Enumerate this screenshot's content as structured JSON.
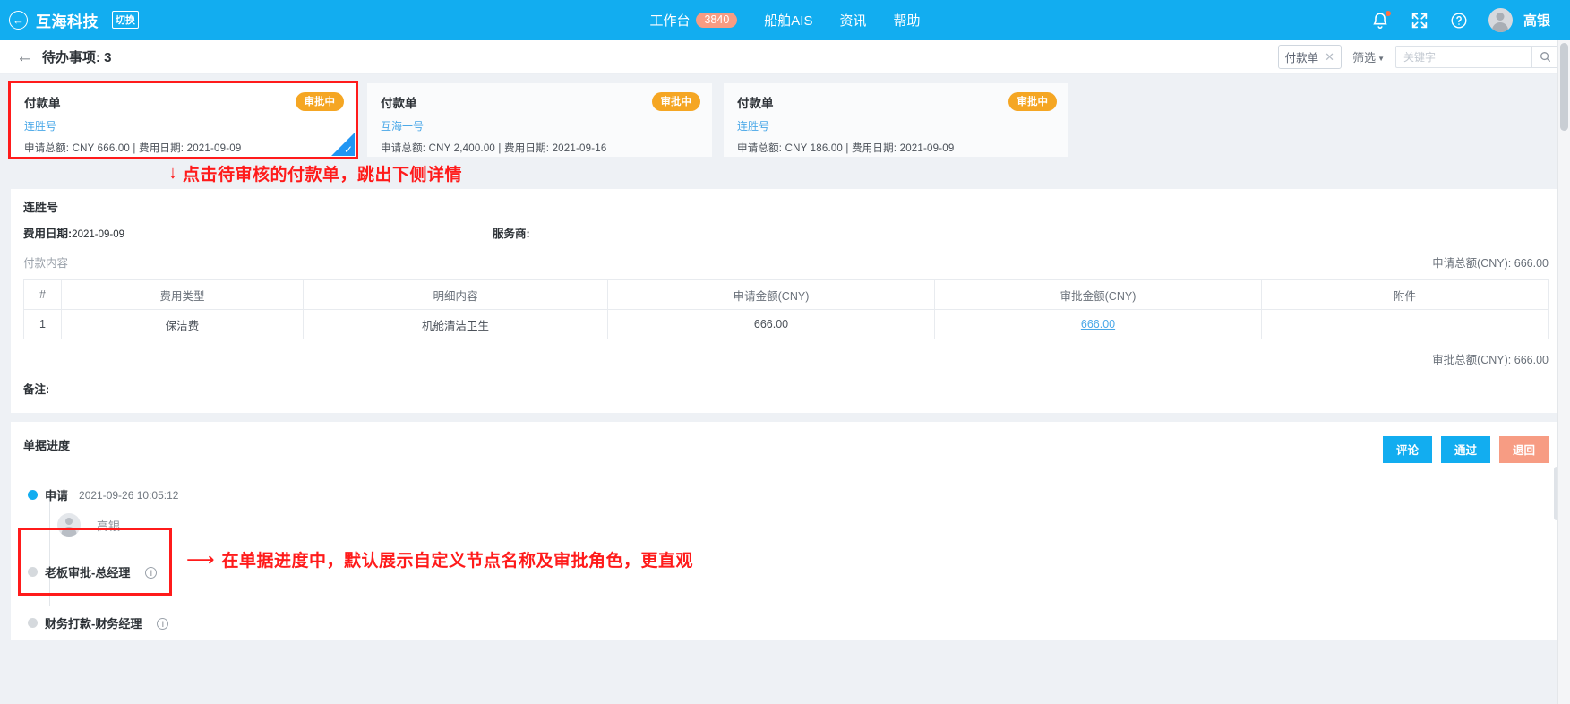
{
  "topbar": {
    "back_icon": "back-arrow-circle-icon",
    "brand": "互海科技",
    "brand_switch": "切换",
    "nav": [
      {
        "label": "工作台",
        "badge": "3840"
      },
      {
        "label": "船舶AIS",
        "badge": ""
      },
      {
        "label": "资讯",
        "badge": ""
      },
      {
        "label": "帮助",
        "badge": ""
      }
    ],
    "icons": [
      "bell-icon",
      "fullscreen-icon",
      "help-icon"
    ],
    "username": "高银",
    "accent_color": "#12ADF0",
    "badge_color": "#F79C83"
  },
  "subheader": {
    "back_arrow": "←",
    "title": "待办事项: 3",
    "chip_label": "付款单",
    "chip_close": "✕",
    "filter_label": "筛选",
    "search_placeholder": "关键字",
    "search_value": "",
    "search_icon": "search-icon"
  },
  "cards": [
    {
      "title": "付款单",
      "ship": "连胜号",
      "meta": "申请总额: CNY  666.00 | 费用日期: 2021-09-09",
      "status": "审批中",
      "selected": true
    },
    {
      "title": "付款单",
      "ship": "互海一号",
      "meta": "申请总额: CNY  2,400.00 | 费用日期: 2021-09-16",
      "status": "审批中",
      "selected": false
    },
    {
      "title": "付款单",
      "ship": "连胜号",
      "meta": "申请总额: CNY  186.00 | 费用日期: 2021-09-09",
      "status": "审批中",
      "selected": false
    }
  ],
  "annotations": {
    "one": "点击待审核的付款单，跳出下侧详情",
    "two": "在单据进度中，默认展示自定义节点名称及审批角色，更直观",
    "color": "#FF1B1B"
  },
  "detail": {
    "ship": "连胜号",
    "fee_date_label": "费用日期:",
    "fee_date_value": "2021-09-09",
    "vendor_label": "服务商:",
    "vendor_value": "",
    "section_label": "付款内容",
    "apply_total": "申请总额(CNY): 666.00",
    "approve_total": "审批总额(CNY): 666.00",
    "remark_label": "备注:",
    "table": {
      "headers": [
        "#",
        "费用类型",
        "明细内容",
        "申请金额(CNY)",
        "审批金额(CNY)",
        "附件"
      ],
      "rows": [
        {
          "index": "1",
          "type": "保洁费",
          "desc": "机舱清洁卫生",
          "apply": "666.00",
          "approve": "666.00",
          "attachment": ""
        }
      ]
    }
  },
  "progress": {
    "title": "单据进度",
    "buttons": [
      {
        "label": "评论",
        "style": "blue"
      },
      {
        "label": "通过",
        "style": "blue"
      },
      {
        "label": "退回",
        "style": "salmon"
      }
    ],
    "nodes": [
      {
        "label": "申请",
        "time": "2021-09-26 10:05:12",
        "user": "高银",
        "state": "done",
        "info": false
      },
      {
        "label": "老板审批-总经理",
        "time": "",
        "user": "",
        "state": "pending",
        "info": true
      },
      {
        "label": "财务打款-财务经理",
        "time": "",
        "user": "",
        "state": "pending",
        "info": true
      }
    ],
    "info_icon": "info-icon"
  }
}
